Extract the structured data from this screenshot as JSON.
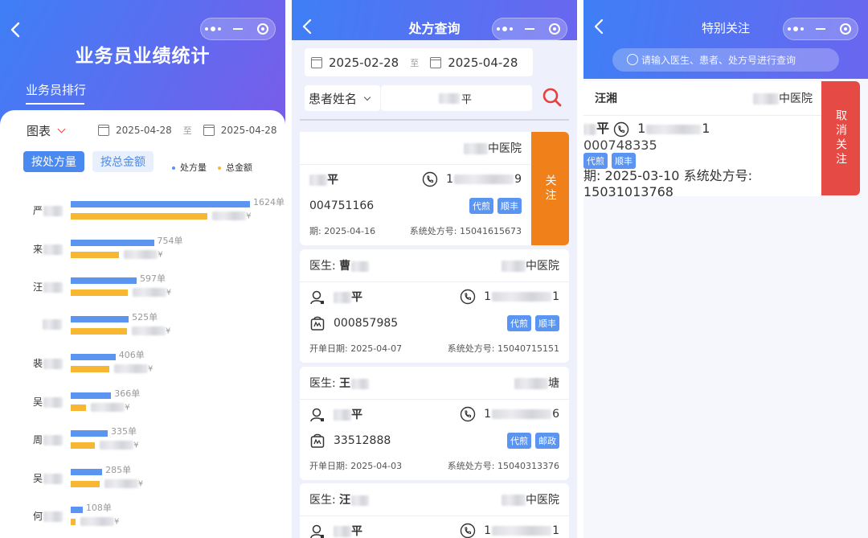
{
  "colors": {
    "primary": "#3e7ff6",
    "bar_count": "#5b95f2",
    "bar_amount": "#f7b733",
    "follow": "#f08019",
    "unfollow": "#e64a45",
    "tag": "#5b95f2"
  },
  "panel1": {
    "title": "业务员业绩统计",
    "tab": "业务员排行",
    "filter_label": "图表",
    "date_start": "2025-04-28",
    "date_sep": "至",
    "date_end": "2025-04-28",
    "btn_by_count": "按处方量",
    "btn_by_amount": "按总金额",
    "legend_count": "处方量",
    "legend_amount": "总金额"
  },
  "chart_data": {
    "type": "bar",
    "orientation": "horizontal",
    "categories": [
      "严",
      "来",
      "汪",
      "",
      "裴",
      "吴",
      "周",
      "吴",
      "何"
    ],
    "series": [
      {
        "name": "处方量",
        "values": [
          1624,
          754,
          597,
          525,
          406,
          366,
          335,
          285,
          108
        ],
        "value_labels": [
          "1624单",
          "754单",
          "597单",
          "525单",
          "406单",
          "366单",
          "335单",
          "285单",
          "108单"
        ]
      },
      {
        "name": "总金额",
        "values": [
          1240,
          440,
          515,
          510,
          350,
          140,
          220,
          260,
          40
        ],
        "unit": "¥"
      }
    ],
    "legend": "top-right"
  },
  "panel2": {
    "title": "处方查询",
    "date_start": "2025-02-28",
    "date_sep": "至",
    "date_end": "2025-04-28",
    "search_type": "患者姓名",
    "search_value": "平",
    "follow_label": "关注",
    "cards": [
      {
        "doctor_label": "",
        "doctor": "",
        "hospital": "中医院",
        "patient": "平",
        "phone_first": "1",
        "phone_last": "9",
        "rx_no": "004751166",
        "tags": [
          "代煎",
          "顺丰"
        ],
        "date_label": "期:",
        "date": "2025-04-16",
        "sys_label": "系统处方号:",
        "sys_no": "15041615673"
      },
      {
        "doctor_label": "医生:",
        "doctor": "曹",
        "hospital": "中医院",
        "patient": "平",
        "phone_first": "1",
        "phone_last": "1",
        "rx_no": "000857985",
        "tags": [
          "代煎",
          "顺丰"
        ],
        "date_label": "开单日期:",
        "date": "2025-04-07",
        "sys_label": "系统处方号:",
        "sys_no": "15040715151"
      },
      {
        "doctor_label": "医生:",
        "doctor": "王",
        "hospital": "塘",
        "patient": "平",
        "phone_first": "1",
        "phone_last": "6",
        "rx_no": "33512888",
        "tags": [
          "代煎",
          "邮政"
        ],
        "date_label": "开单日期:",
        "date": "2025-04-03",
        "sys_label": "系统处方号:",
        "sys_no": "15040313376"
      },
      {
        "doctor_label": "医生:",
        "doctor": "汪",
        "hospital": "中医院",
        "patient": "平",
        "phone_first": "1",
        "phone_last": "1"
      }
    ]
  },
  "panel3": {
    "title": "特别关注",
    "search_placeholder": "请输入医生、患者、处方号进行查询",
    "unfollow_label": "取消关注",
    "card": {
      "doctor": "汪湘",
      "hospital": "中医院",
      "patient": "平",
      "phone_first": "1",
      "phone_last": "1",
      "rx_no": "000748335",
      "tags": [
        "代煎",
        "顺丰"
      ],
      "date_label": "期:",
      "date": "2025-03-10",
      "sys_label": "系统处方号:",
      "sys_no": "15031013768"
    }
  }
}
